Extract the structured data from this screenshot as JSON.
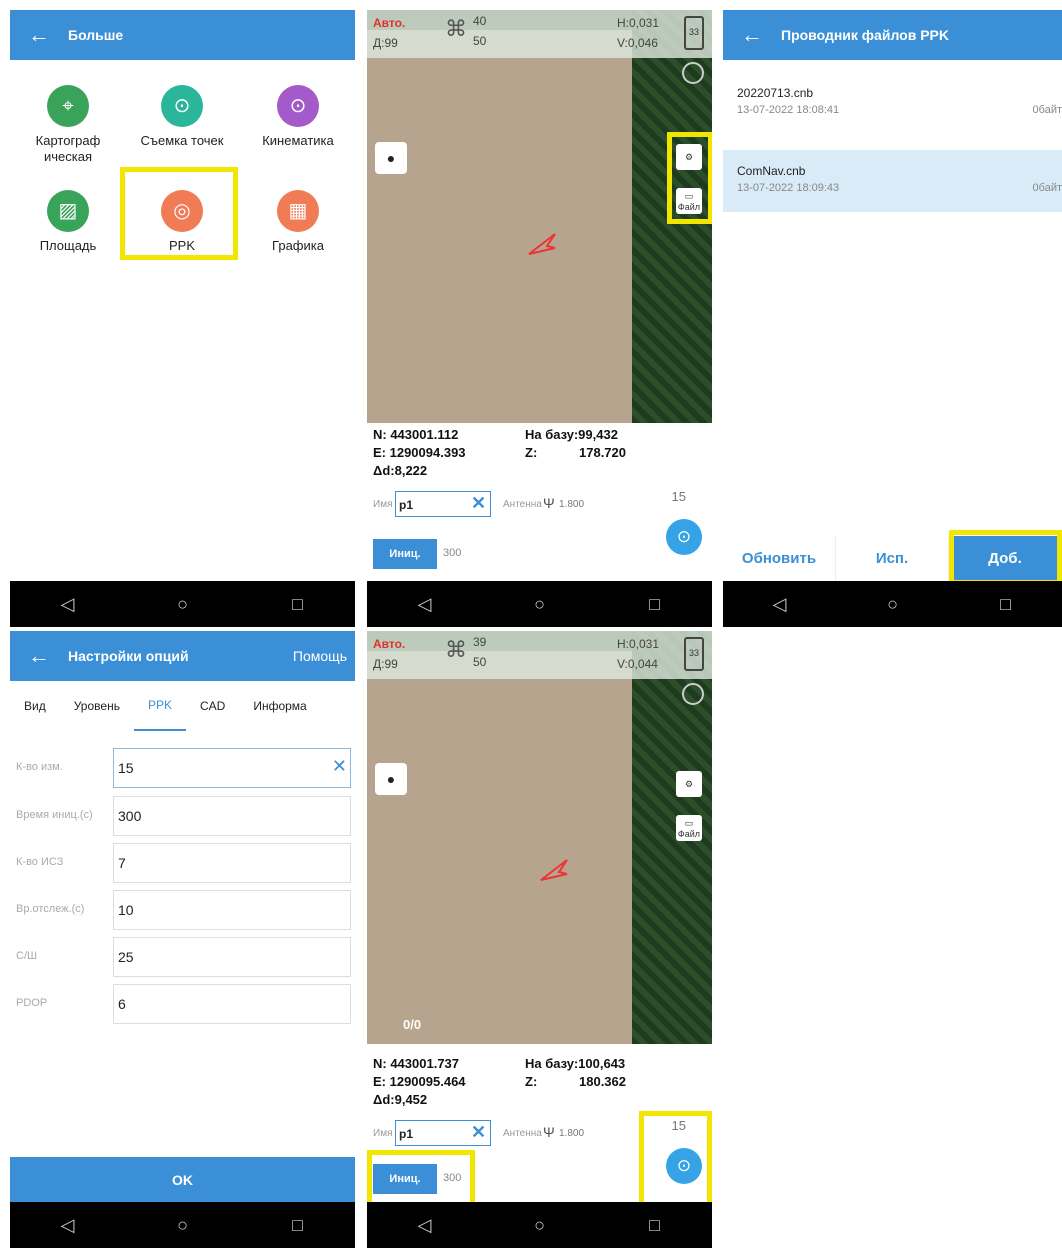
{
  "panel1": {
    "title": "Больше",
    "items": [
      {
        "label": "Картограф ическая",
        "icon": "map-pin-icon",
        "color": "#3aa35a"
      },
      {
        "label": "Съемка точек",
        "icon": "point-survey-icon",
        "color": "#2bb59a"
      },
      {
        "label": "Кинематика",
        "icon": "kinematic-icon",
        "color": "#a45ac9"
      },
      {
        "label": "Площадь",
        "icon": "area-icon",
        "color": "#3aa35a"
      },
      {
        "label": "PPK",
        "icon": "ppk-icon",
        "color": "#f07b55"
      },
      {
        "label": "Графика",
        "icon": "graphics-icon",
        "color": "#f07b55"
      }
    ]
  },
  "map1": {
    "status": {
      "mode": "Авто.",
      "d": "Д:99",
      "sat1": "40",
      "sat2": "50",
      "h": "H:0,031",
      "v": "V:0,046",
      "battery": "33"
    },
    "n": "N: 443001.112",
    "e": "E: 1290094.393",
    "dd": "Δd:8,222",
    "base": "На базу:99,432",
    "z_label": "Z:",
    "z_val": "178.720",
    "name_label": "Имя",
    "name_value": "p1",
    "antenna_label": "Антенна",
    "antenna_value": "1.800",
    "count": "15",
    "init_label": "Иниц.",
    "init_value": "300",
    "file_label": "Файл"
  },
  "panel3": {
    "title": "Проводник файлов PPK",
    "files": [
      {
        "name": "20220713.cnb",
        "date": "13-07-2022 18:08:41",
        "size": "0байт"
      },
      {
        "name": "ComNav.cnb",
        "date": "13-07-2022 18:09:43",
        "size": "0байт"
      }
    ],
    "btn_refresh": "Обновить",
    "btn_use": "Исп.",
    "btn_add": "Доб."
  },
  "panel4": {
    "title": "Настройки опций",
    "help": "Помощь",
    "tabs": [
      "Вид",
      "Уровень",
      "PPK",
      "CAD",
      "Информа"
    ],
    "fields": [
      {
        "label": "К-во изм.",
        "value": "15"
      },
      {
        "label": "Время иниц.(с)",
        "value": "300"
      },
      {
        "label": "К-во ИСЗ",
        "value": "7"
      },
      {
        "label": "Вр.отслеж.(с)",
        "value": "10"
      },
      {
        "label": "С/Ш",
        "value": "25"
      },
      {
        "label": "PDOP",
        "value": "6"
      }
    ],
    "ok": "OK"
  },
  "map2": {
    "status": {
      "mode": "Авто.",
      "d": "Д:99",
      "sat1": "39",
      "sat2": "50",
      "h": "H:0,031",
      "v": "V:0,044",
      "battery": "33"
    },
    "progress": "0/0",
    "n": "N: 443001.737",
    "e": "E: 1290095.464",
    "dd": "Δd:9,452",
    "base": "На базу:100,643",
    "z_label": "Z:",
    "z_val": "180.362",
    "name_label": "Имя",
    "name_value": "p1",
    "antenna_label": "Антенна",
    "antenna_value": "1.800",
    "count": "15",
    "init_label": "Иниц.",
    "init_value": "300",
    "file_label": "Файл"
  },
  "nav": {
    "back": "◁",
    "home": "○",
    "recent": "□"
  },
  "colors": {
    "accent": "#3b8fd6",
    "highlight": "#f2e600",
    "auto": "#e0322c"
  }
}
